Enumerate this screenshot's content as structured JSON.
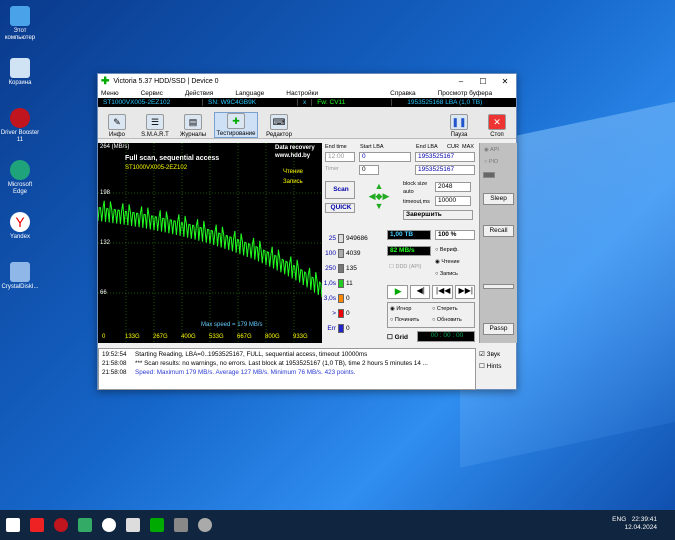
{
  "desktop": {
    "icons": [
      "Этот компьютер",
      "Корзина",
      "Driver Booster 11",
      "Microsoft Edge",
      "Yandex",
      "CrystalDiskI..."
    ]
  },
  "window": {
    "title": "Victoria 5.37 HDD/SSD | Device 0",
    "menu": [
      "Меню",
      "Сервис",
      "Действия",
      "Language",
      "Настройки",
      "Справка"
    ],
    "buffer": "Просмотр буфера",
    "info": {
      "model": "ST1000VX005-2EZ102",
      "sn": "SN: W9C4GB9K",
      "x": "x",
      "fw": "Fw: CV11",
      "lba": "1953525168 LBA (1,0 TB)"
    },
    "toolbar": [
      "Инфо",
      "S.M.A.R.T",
      "Журналы",
      "Тестирование",
      "Редактор"
    ],
    "pause": "Пауза",
    "stop": "Стоп",
    "graph": {
      "scale_top": "264 (MB/s)",
      "y_ticks": [
        "198",
        "132",
        "66"
      ],
      "x_ticks": [
        "0",
        "133G",
        "267G",
        "400G",
        "533G",
        "667G",
        "800G",
        "933G"
      ],
      "title": "Full scan, sequential access",
      "model": "ST1000VX005-2EZ102",
      "recovery": "Data recovery",
      "url": "www.hdd.by",
      "read": "Чтение",
      "write": "Запись",
      "max_speed": "Max speed = 179 MB/s"
    },
    "chart_data": {
      "type": "line",
      "xlabel": "LBA",
      "ylabel": "MB/s",
      "ylim": [
        0,
        264
      ],
      "x": [
        0,
        100,
        200,
        300,
        400,
        500,
        600,
        700,
        800,
        900,
        1000
      ],
      "values": [
        179,
        175,
        170,
        164,
        157,
        149,
        139,
        128,
        114,
        98,
        78
      ]
    },
    "endtime": "End time",
    "time_val": "12:00",
    "timer": "Timer",
    "timer_val": "0",
    "start_lba": "Start LBA",
    "end_lba": "End LBA",
    "cur": "CUR",
    "max": "MAX",
    "start_val": "0",
    "end_val": "1953525167",
    "cur_val": "1953525167",
    "scan": "Scan",
    "quick": "QUICK",
    "block_size": "block size",
    "auto": "auto",
    "block_val": "2048",
    "timeout": "timeout,ms",
    "timeout_val": "10000",
    "finish": "Завершить",
    "blocks": [
      {
        "t": "25",
        "n": "949686",
        "c": "#ddd"
      },
      {
        "t": "100",
        "n": "4039",
        "c": "#aaa"
      },
      {
        "t": "250",
        "n": "135",
        "c": "#777"
      },
      {
        "t": "1,0s",
        "n": "11",
        "c": "#2c2"
      },
      {
        "t": "3,0s",
        "n": "0",
        "c": "#f80"
      },
      {
        "t": ">",
        "n": "0",
        "c": "#e00"
      },
      {
        "t": "Err",
        "n": "0",
        "c": "#22c"
      }
    ],
    "progress": "1,00 TB",
    "percent": "100",
    "pct_sign": "%",
    "speed": "82 MB/s",
    "ddd": "DDD (API)",
    "verify": "Вериф.",
    "reading": "Чтение",
    "writing": "Запись",
    "ignore": "Игнор",
    "erase": "Стереть",
    "fix": "Починить",
    "update": "Обновить",
    "grid": "Grid",
    "clock": "00 : 00 : 00",
    "api": "API",
    "pio": "PIO",
    "sleep": "Sleep",
    "recall": "Recall",
    "passp": "Passp",
    "sound": "Звук",
    "hints": "Hints",
    "log": [
      {
        "t": "19:52:54",
        "m": "Starting Reading, LBA=0..1953525167, FULL, sequential access, timeout 10000ms",
        "c": "#000"
      },
      {
        "t": "21:58:08",
        "m": "*** Scan results: no warnings, no errors. Last block at 1953525167 (1,0 TB), time 2 hours 5 minutes 14 ...",
        "c": "#000"
      },
      {
        "t": "21:58:08",
        "m": "Speed: Maximum 179 MB/s. Average 127 MB/s. Minimum 76 MB/s. 423 points.",
        "c": "#2a3ad0"
      }
    ]
  },
  "taskbar": {
    "lang": "ENG",
    "time": "22:39:41",
    "date": "12.04.2024"
  }
}
